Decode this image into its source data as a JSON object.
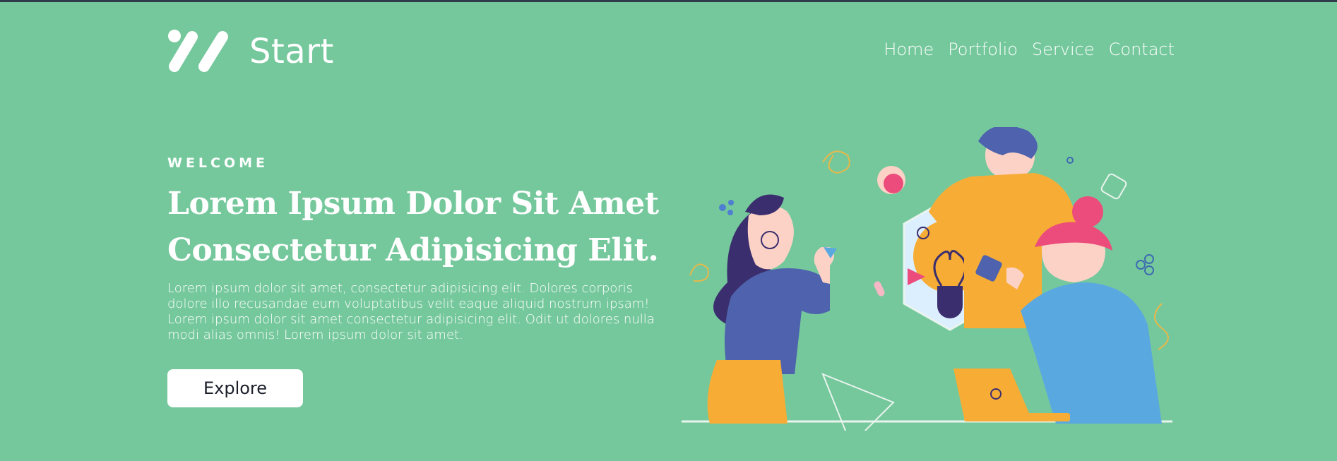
{
  "brand": {
    "name": "Start",
    "logo_icon": "slash-marks-logo"
  },
  "nav": {
    "items": [
      "Home",
      "Portfolio",
      "Service",
      "Contact"
    ]
  },
  "hero": {
    "eyebrow": "WELCOME",
    "headline_line1": "Lorem Ipsum Dolor Sit Amet",
    "headline_line2": "Consectetur Adipisicing Elit.",
    "description": "Lorem ipsum dolor sit amet, consectetur adipisicing elit. Dolores corporis dolore illo recusandae eum voluptatibus velit eaque aliquid nostrum ipsam! Lorem ipsum dolor sit amet consectetur adipisicing elit. Odit ut dolores nulla modi alias omnis! Lorem ipsum dolor sit amet.",
    "cta_label": "Explore",
    "illustration_icon": "team-idea-lightbulb-illustration"
  },
  "colors": {
    "background": "#75c89c",
    "text": "#ffffff",
    "button_bg": "#ffffff",
    "button_text": "#1a1f2a",
    "accent_yellow": "#f7ad35",
    "accent_blue": "#4e62ad",
    "accent_pink": "#ec4c7b"
  }
}
